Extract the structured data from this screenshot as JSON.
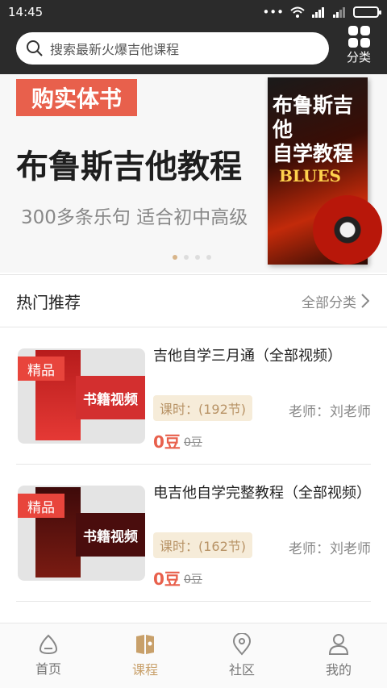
{
  "status_bar": {
    "time": "14:45"
  },
  "search": {
    "placeholder": "搜索最新火爆吉他课程"
  },
  "category_button": {
    "label": "分类"
  },
  "banner": {
    "tag": "购实体书",
    "title": "布鲁斯吉他教程",
    "subtitle": "300多条乐句  适合初中高级",
    "book_title_line1": "布鲁斯吉他",
    "book_title_line2": "自学教程",
    "book_word": "BLUES",
    "dots_total": 4,
    "active_dot": 1
  },
  "section": {
    "title": "热门推荐",
    "all_label": "全部分类"
  },
  "courses": [
    {
      "badge": "精品",
      "strip": "书籍视频",
      "name": "吉他自学三月通（全部视频）",
      "hours": "课时：(192节)",
      "teacher": "老师：刘老师",
      "price": "0豆",
      "original_price": "0豆"
    },
    {
      "badge": "精品",
      "strip": "书籍视频",
      "name": "电吉他自学完整教程（全部视频）",
      "hours": "课时：(162节)",
      "teacher": "老师：刘老师",
      "price": "0豆",
      "original_price": "0豆"
    }
  ],
  "tabs": [
    {
      "label": "首页",
      "icon": "home-icon"
    },
    {
      "label": "课程",
      "icon": "course-book-icon",
      "active": true
    },
    {
      "label": "社区",
      "icon": "community-icon"
    },
    {
      "label": "我的",
      "icon": "profile-icon"
    }
  ],
  "colors": {
    "accent": "#c8a06a",
    "price": "#e8604c",
    "badge": "#e8453c",
    "topbar": "#2b2b2b"
  }
}
